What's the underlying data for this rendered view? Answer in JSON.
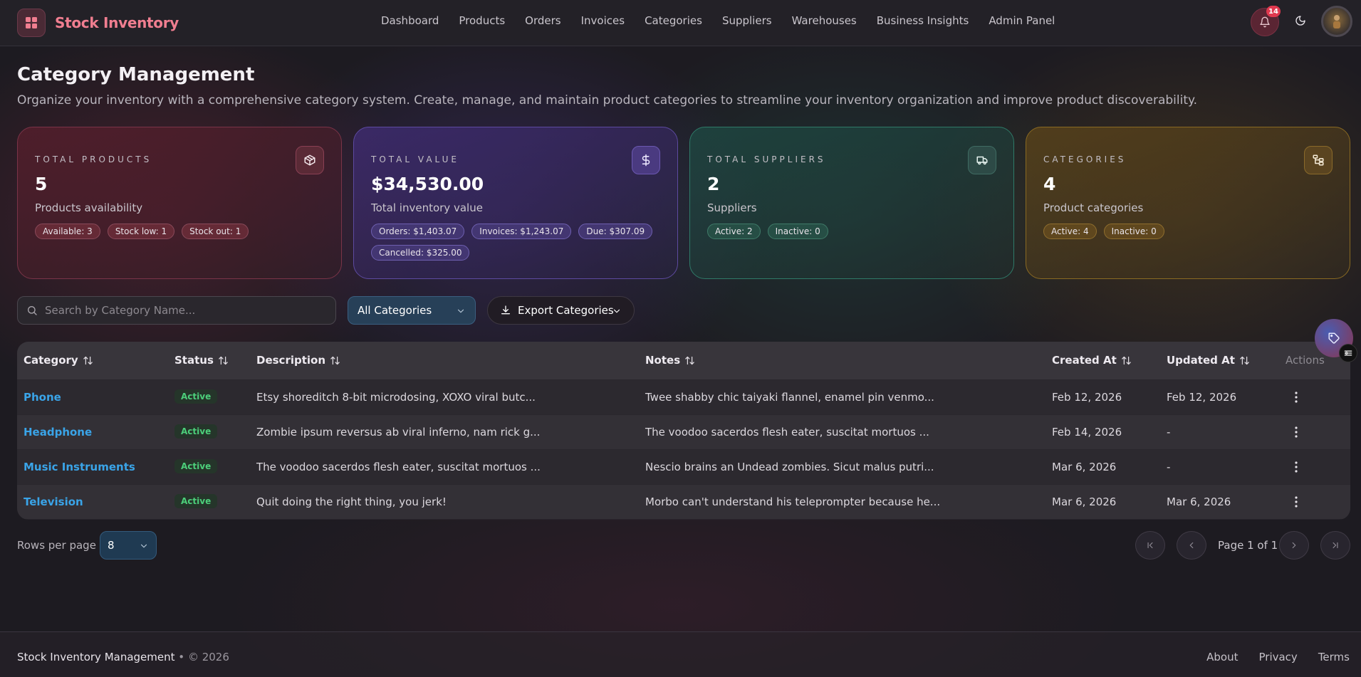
{
  "brand": {
    "name": "Stock Inventory",
    "logo_icon": "grid-icon",
    "accent": "#f07e90"
  },
  "nav": [
    "Dashboard",
    "Products",
    "Orders",
    "Invoices",
    "Categories",
    "Suppliers",
    "Warehouses",
    "Business Insights",
    "Admin Panel"
  ],
  "header": {
    "notification_count": "14"
  },
  "page": {
    "title": "Category Management",
    "subtitle": "Organize your inventory with a comprehensive category system. Create, manage, and maintain product categories to streamline your inventory organization and improve product discoverability."
  },
  "cards": [
    {
      "label": "TOTAL PRODUCTS",
      "value": "5",
      "desc": "Products availability",
      "icon": "box-icon",
      "color": "#d0466a",
      "pills": [
        "Available: 3",
        "Stock low: 1",
        "Stock out: 1"
      ]
    },
    {
      "label": "TOTAL VALUE",
      "value": "$34,530.00",
      "desc": "Total inventory value",
      "icon": "dollar-icon",
      "color": "#7a62d8",
      "pills": [
        "Orders: $1,403.07",
        "Invoices: $1,243.07",
        "Due: $307.09",
        "Cancelled: $325.00"
      ]
    },
    {
      "label": "TOTAL SUPPLIERS",
      "value": "2",
      "desc": "Suppliers",
      "icon": "truck-icon",
      "color": "#3aa58a",
      "pills": [
        "Active: 2",
        "Inactive: 0"
      ]
    },
    {
      "label": "CATEGORIES",
      "value": "4",
      "desc": "Product categories",
      "icon": "hierarchy-icon",
      "color": "#c99a2e",
      "pills": [
        "Active: 4",
        "Inactive: 0"
      ]
    }
  ],
  "toolbar": {
    "search_placeholder": "Search by Category Name...",
    "filter_value": "All Categories",
    "export_label": "Export Categories"
  },
  "table": {
    "columns": [
      "Category",
      "Status",
      "Description",
      "Notes",
      "Created At",
      "Updated At",
      "Actions"
    ],
    "rows": [
      {
        "category": "Phone",
        "status": "Active",
        "description": "Etsy shoreditch 8-bit microdosing, XOXO viral butc...",
        "notes": "Twee shabby chic taiyaki flannel, enamel pin venmo...",
        "created": "Feb 12, 2026",
        "updated": "Feb 12, 2026"
      },
      {
        "category": "Headphone",
        "status": "Active",
        "description": "Zombie ipsum reversus ab viral inferno, nam rick g...",
        "notes": "The voodoo sacerdos flesh eater, suscitat mortuos ...",
        "created": "Feb 14, 2026",
        "updated": "-"
      },
      {
        "category": "Music Instruments",
        "status": "Active",
        "description": "The voodoo sacerdos flesh eater, suscitat mortuos ...",
        "notes": "Nescio brains an Undead zombies. Sicut malus putri...",
        "created": "Mar 6, 2026",
        "updated": "-"
      },
      {
        "category": "Television",
        "status": "Active",
        "description": "Quit doing the right thing, you jerk!",
        "notes": "Morbo can't understand his teleprompter because he...",
        "created": "Mar 6, 2026",
        "updated": "Mar 6, 2026"
      }
    ]
  },
  "pagination": {
    "rows_label": "Rows per page",
    "rows_value": "8",
    "page_text": "Page 1 of 1"
  },
  "footer": {
    "app_name": "Stock Inventory Management",
    "separator": "•",
    "copyright": "© 2026",
    "links": [
      "About",
      "Privacy",
      "Terms"
    ]
  }
}
